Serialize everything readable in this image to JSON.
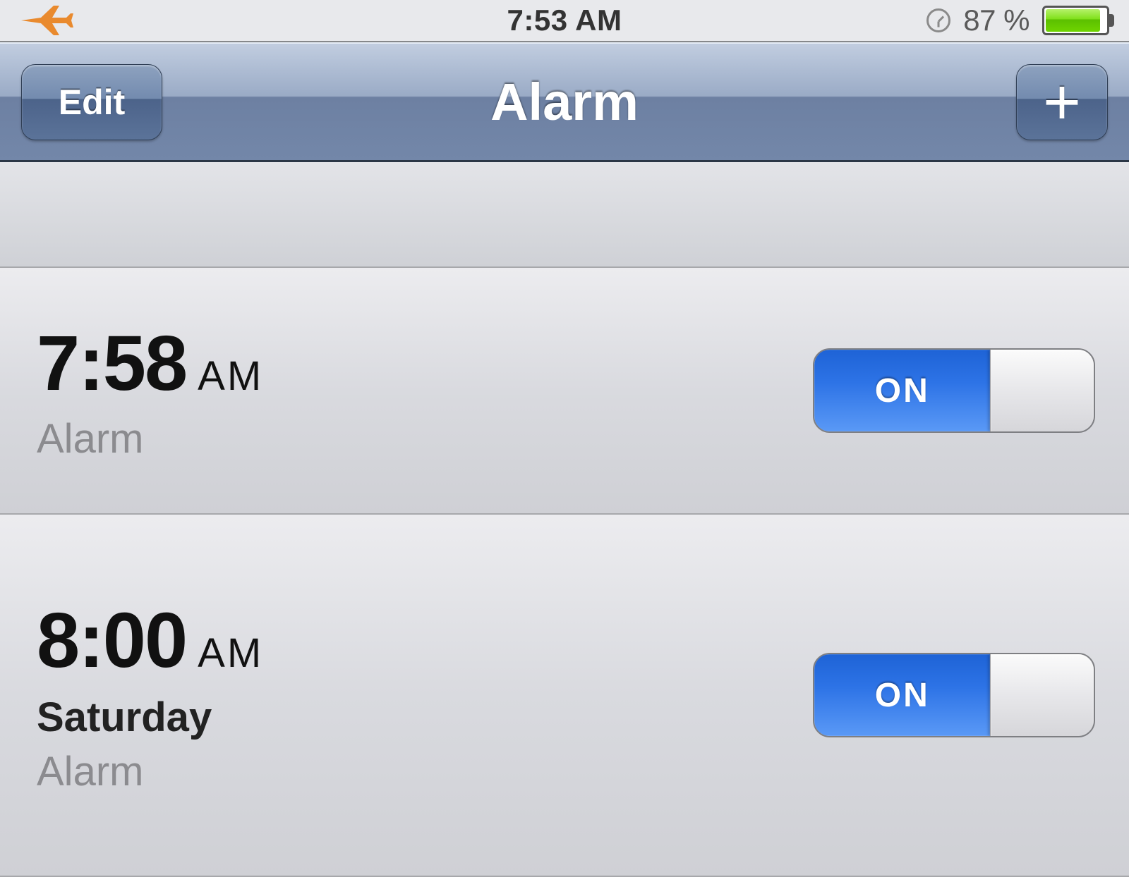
{
  "status": {
    "time": "7:53 AM",
    "battery_pct": "87 %"
  },
  "nav": {
    "edit_label": "Edit",
    "title": "Alarm",
    "add_label": "+"
  },
  "toggle": {
    "on_label": "ON"
  },
  "alarms": [
    {
      "time": "7:58",
      "ampm": "AM",
      "repeat": "",
      "label": "Alarm",
      "on": true
    },
    {
      "time": "8:00",
      "ampm": "AM",
      "repeat": "Saturday",
      "label": "Alarm",
      "on": true
    }
  ]
}
